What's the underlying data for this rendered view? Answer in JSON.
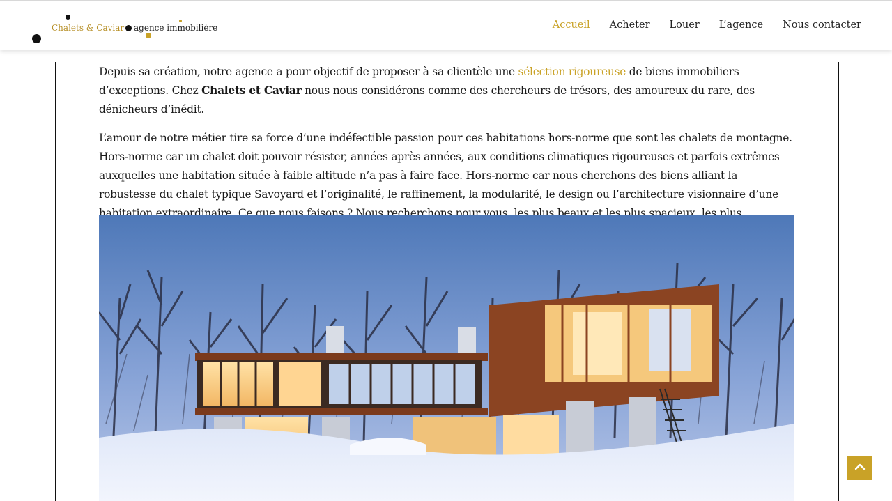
{
  "header": {
    "logo": {
      "brand_name": "Chalets & Caviar",
      "tagline": "agence immobilière"
    },
    "nav": [
      {
        "label": "Accueil",
        "active": true
      },
      {
        "label": "Acheter",
        "active": false
      },
      {
        "label": "Louer",
        "active": false
      },
      {
        "label": "L’agence",
        "active": false
      },
      {
        "label": "Nous contacter",
        "active": false
      }
    ]
  },
  "content": {
    "p1": {
      "part1": "Depuis sa création, notre agence a pour objectif de proposer à sa clientèle une ",
      "link": "sélection rigoureuse",
      "part2": " de biens immobiliers d’exceptions. Chez ",
      "bold": "Chalets et Caviar",
      "part3": " nous nous considérons comme des chercheurs de trésors, des amoureux du rare, des dénicheurs d’inédit."
    },
    "p2": "L’amour de notre métier tire sa force d’une indéfectible passion pour ces habitations hors-norme que sont les chalets de montagne. Hors-norme car un chalet doit pouvoir résister, années après années, aux conditions climatiques rigoureuses et parfois extrêmes auxquelles une habitation située à faible altitude n’a pas à faire face. Hors-norme car nous cherchons des biens alliant la robustesse du chalet typique Savoyard et l’originalité, le raffinement, la modularité, le design ou l’architecture visionnaire d’une habitation extraordinaire. Ce que nous faisons ? Nous recherchons pour vous, les plus beaux et les plus spacieux, les plus modernes et les plus étonnants chalets de la région."
  },
  "colors": {
    "accent": "#c9a227",
    "text": "#1a1a1a",
    "sky": "#5f86c4",
    "snow": "#e8eefa",
    "wood": "#9a4a22"
  },
  "icons": {
    "back_to_top": "chevron-up-icon"
  }
}
